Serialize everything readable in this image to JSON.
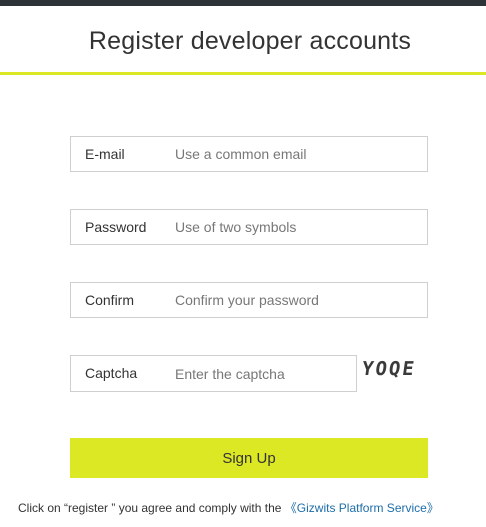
{
  "header": {
    "title": "Register developer accounts",
    "accent_color": "#dde825",
    "topbar_color": "#2e3338"
  },
  "form": {
    "email": {
      "label": "E-mail",
      "placeholder": "Use a common email"
    },
    "password": {
      "label": "Password",
      "placeholder": "Use of two symbols"
    },
    "confirm": {
      "label": "Confirm",
      "placeholder": "Confirm your password"
    },
    "captcha": {
      "label": "Captcha",
      "placeholder": "Enter the captcha",
      "image_text": "YOQE"
    },
    "submit_label": "Sign Up"
  },
  "footer": {
    "agree_prefix": "Click on  “register ” you agree and comply with the ",
    "terms_link": "《Gizwits Platform Service》"
  }
}
